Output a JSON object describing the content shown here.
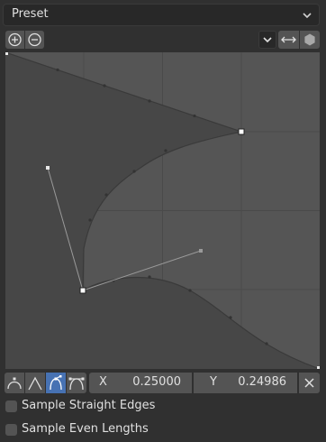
{
  "preset": {
    "label": "Preset"
  },
  "toolbar": {
    "x_label": "X",
    "x_value": "0.25000",
    "y_label": "Y",
    "y_value": "0.24986"
  },
  "options": {
    "sample_straight_edges": "Sample Straight Edges",
    "sample_even_lengths": "Sample Even Lengths"
  },
  "icons": {
    "zoom_in": "zoom-in-icon",
    "zoom_out": "zoom-out-icon",
    "handle_type_dropdown": "chevron-down-icon",
    "extrapolation": "arrows-horizontal-icon",
    "reset": "hexagon-icon",
    "delete": "close-icon"
  },
  "colors": {
    "background": "#303030",
    "graph_background": "#555555",
    "curve_fill": "#474747",
    "active_handle": "#4772b3"
  }
}
